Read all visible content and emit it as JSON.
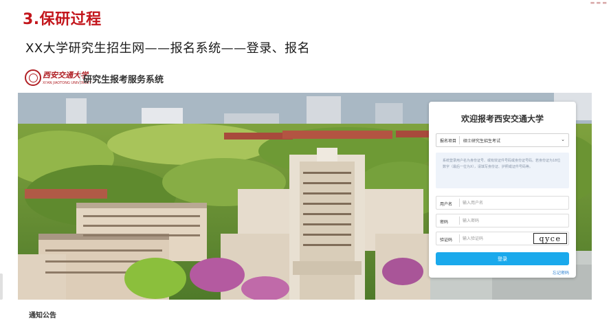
{
  "slide": {
    "title": "3.保研过程",
    "subtitle": "XX大学研究生招生网——报名系统——登录、报名"
  },
  "site": {
    "logo_text": "西安交通大学",
    "logo_subtext": "XI'AN JIAOTONG UNIVERSITY",
    "system_name": "研究生报考服务系统"
  },
  "login": {
    "title": "欢迎报考西安交通大学",
    "project_label": "报名项目",
    "project_value": "硕士研究生招生考试",
    "notice": "系统登录用户名为身份证号、或有效证件号码或身份证号码。若身份证为18位数字（最后一位为X），请填写身份证、护照或证件号码等。",
    "username_label": "用户名",
    "username_placeholder": "输入用户名",
    "password_label": "密码",
    "password_placeholder": "输入密码",
    "captcha_label": "验证码",
    "captcha_placeholder": "输入验证码",
    "captcha_text": "qyce",
    "login_button": "登录",
    "forgot_link": "忘记密码"
  },
  "footer": {
    "notice_heading": "通知公告"
  },
  "colors": {
    "title_red": "#c3161c",
    "brand_red": "#b01f24",
    "button_blue": "#1aa9ec",
    "link_blue": "#2a7fd0"
  }
}
